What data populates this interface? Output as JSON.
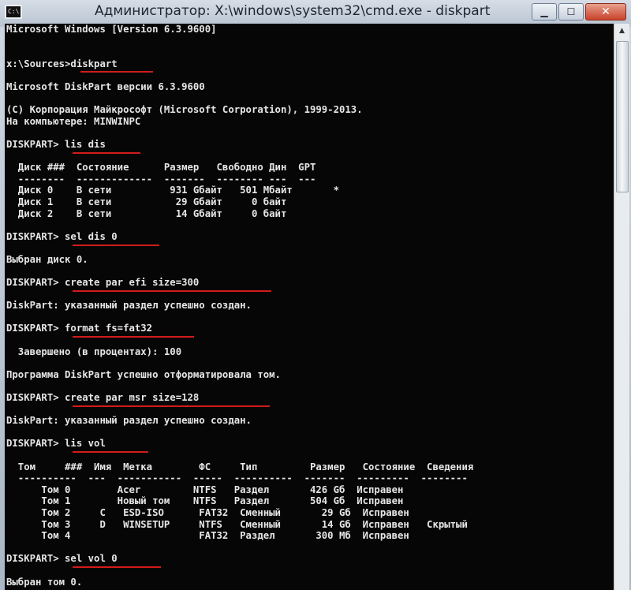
{
  "window": {
    "title": "Администратор: X:\\windows\\system32\\cmd.exe - diskpart",
    "icon_label": "C:\\",
    "buttons": {
      "minimize": "▁",
      "maximize": "☐",
      "close": "✕"
    }
  },
  "console": {
    "lines": [
      "Microsoft Windows [Version 6.3.9600]",
      "",
      "",
      "x:\\Sources>diskpart",
      "",
      "Microsoft DiskPart версии 6.3.9600",
      "",
      "(C) Корпорация Майкрософт (Microsoft Corporation), 1999-2013.",
      "На компьютере: MINWINPC",
      "",
      "DISKPART> lis dis",
      "",
      "  Диск ###  Состояние      Размер   Свободно Дин  GPT",
      "  --------  -------------  -------  -------- ---  ---",
      "  Диск 0    В сети          931 Gбайт   501 Мбайт       *",
      "  Диск 1    В сети           29 Gбайт     0 байт",
      "  Диск 2    В сети           14 Gбайт     0 байт",
      "",
      "DISKPART> sel dis 0",
      "",
      "Выбран диск 0.",
      "",
      "DISKPART> create par efi size=300",
      "",
      "DiskPart: указанный раздел успешно создан.",
      "",
      "DISKPART> format fs=fat32",
      "",
      "  Завершено (в процентах): 100",
      "",
      "Программа DiskPart успешно отформатировала том.",
      "",
      "DISKPART> create par msr size=128",
      "",
      "DiskPart: указанный раздел успешно создан.",
      "",
      "DISKPART> lis vol",
      "",
      "  Том     ###  Имя  Метка        ФС     Тип         Размер   Состояние  Сведения",
      "  ----------  ---  -----------  -----  ----------  -------  ---------  --------",
      "      Том 0        Acer         NTFS   Раздел       426 Gб  Исправен",
      "      Том 1        Новый том    NTFS   Раздел       504 Gб  Исправен",
      "      Том 2     C   ESD-ISO      FAT32  Сменный       29 Gб  Исправен",
      "      Том 3     D   WINSETUP     NTFS   Сменный       14 Gб  Исправен   Скрытый",
      "      Том 4                      FAT32  Раздел       300 Мб  Исправен",
      "",
      "DISKPART> sel vol 0",
      "",
      "Выбран том 0."
    ]
  }
}
